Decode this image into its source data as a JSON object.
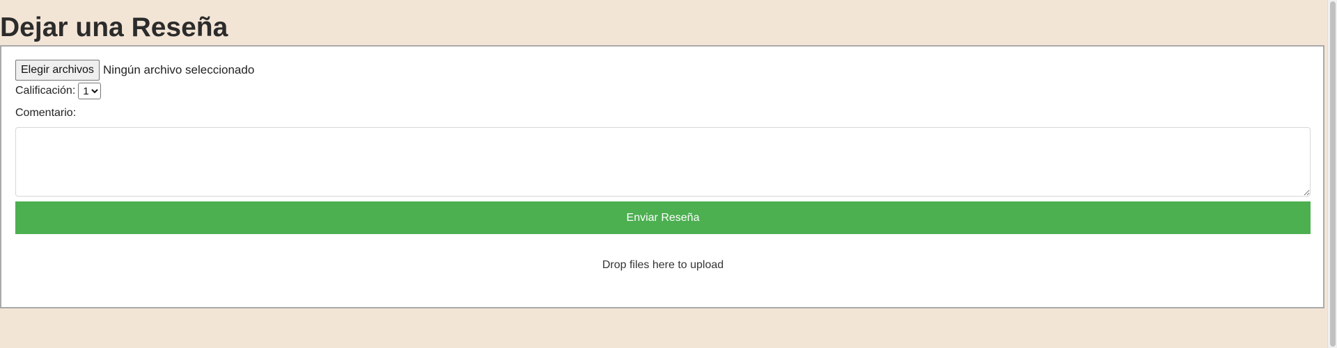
{
  "page": {
    "title": "Dejar una Reseña"
  },
  "form": {
    "file_button_label": "Elegir archivos",
    "file_status": "Ningún archivo seleccionado",
    "rating_label": "Calificación:",
    "rating_selected": "1",
    "comment_label": "Comentario:",
    "comment_value": "",
    "submit_label": "Enviar Reseña",
    "drop_text": "Drop files here to upload"
  },
  "colors": {
    "page_background": "#f3e5d6",
    "submit_button": "#4caf50",
    "panel_background": "#ffffff"
  }
}
